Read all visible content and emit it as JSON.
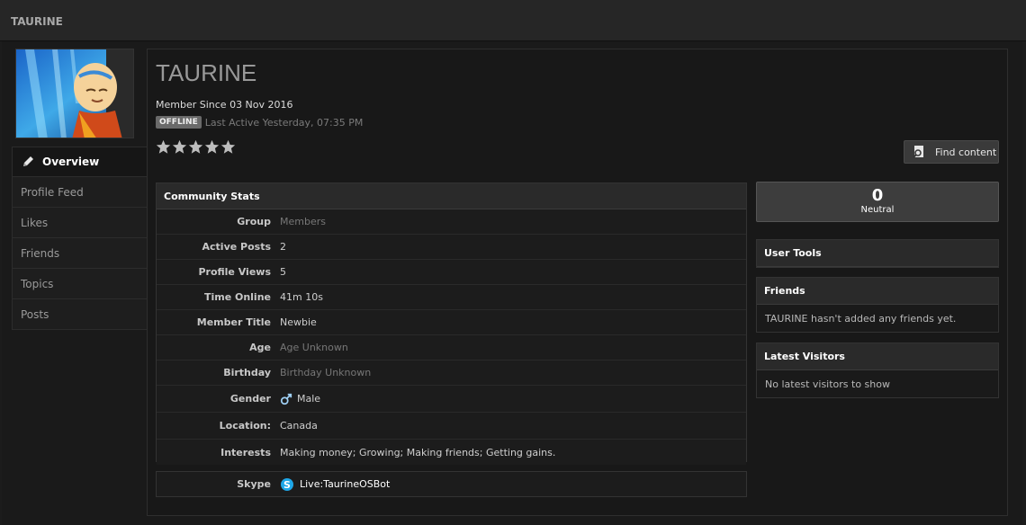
{
  "header": {
    "title": "TAURINE"
  },
  "profile": {
    "username": "TAURINE",
    "member_since": "Member Since 03 Nov 2016",
    "status_badge": "OFFLINE",
    "last_active": "Last Active Yesterday, 07:35 PM",
    "star_rating": 0,
    "star_max": 5
  },
  "sidebar": {
    "items": [
      {
        "label": "Overview",
        "active": true
      },
      {
        "label": "Profile Feed"
      },
      {
        "label": "Likes"
      },
      {
        "label": "Friends"
      },
      {
        "label": "Topics"
      },
      {
        "label": "Posts"
      }
    ]
  },
  "actions": {
    "find_content": "Find content"
  },
  "community_stats": {
    "title": "Community Stats",
    "rows": [
      {
        "label": "Group",
        "value": "Members"
      },
      {
        "label": "Active Posts",
        "value": "2"
      },
      {
        "label": "Profile Views",
        "value": "5"
      },
      {
        "label": "Time Online",
        "value": "41m 10s"
      },
      {
        "label": "Member Title",
        "value": "Newbie"
      },
      {
        "label": "Age",
        "value": "Age Unknown"
      },
      {
        "label": "Birthday",
        "value": "Birthday Unknown"
      },
      {
        "label": "Gender",
        "value": "Male"
      },
      {
        "label": "Location:",
        "value": "Canada"
      },
      {
        "label": "Interests",
        "value": "Making money; Growing; Making friends; Getting gains."
      }
    ]
  },
  "skype": {
    "label": "Skype",
    "value": "Live:TaurineOSBot"
  },
  "reputation": {
    "value": "0",
    "label": "Neutral"
  },
  "user_tools": {
    "title": "User Tools"
  },
  "friends_panel": {
    "title": "Friends",
    "text": "TAURINE hasn't added any friends yet."
  },
  "visitors_panel": {
    "title": "Latest Visitors",
    "text": "No latest visitors to show"
  },
  "colors": {
    "accent": "#ffffff",
    "panel_header": "#2a2a2a",
    "background": "#1a1a1a",
    "badge": "#6a6a6a"
  }
}
